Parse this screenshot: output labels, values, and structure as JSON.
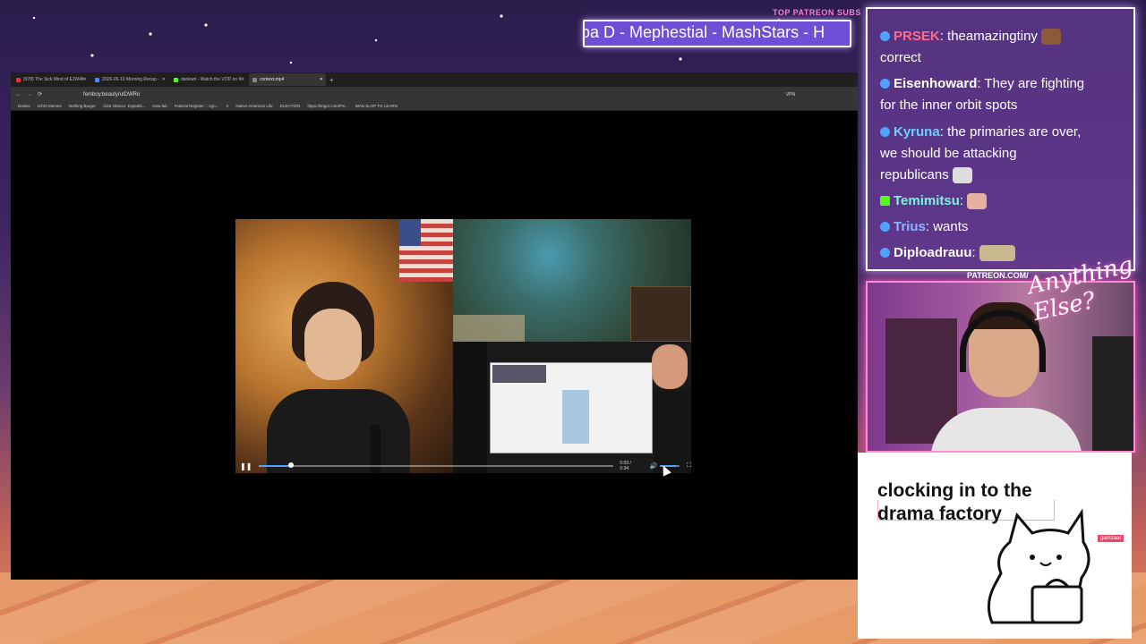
{
  "overlay": {
    "top_label": "TOP PATREON SUBS",
    "ticker_text": "oa D - Mephestial - MashStars - H",
    "patreon_label": "PATREON.COM/",
    "script_logo": "Anything Else?",
    "note_text": "clocking in to the drama factory",
    "note_tag": "gamzaar"
  },
  "browser": {
    "tabs": [
      {
        "label": "(978) The Sick Mind of EJW4K",
        "color": "#e33"
      },
      {
        "label": "2026-06-10 Morning Recap - ",
        "color": "#4a8cff"
      },
      {
        "label": "dankwrl - Watch the VOD on K",
        "color": "#53fc18"
      },
      {
        "label": "context.mp4",
        "color": "#888"
      }
    ],
    "new_tab": "+",
    "url": "femboy.beauty/utDWRo",
    "vpn_label": "VPN",
    "bookmarks": [
      "Dailies",
      "10/10 Memes",
      "Nothing Burger",
      "Clair Obscur: Expediti...",
      "Now lab",
      "Federal Register :: Ago...",
      "X",
      "Native American Libr",
      "ELECTION",
      "https://imgur.com/PS...",
      "WAN SLOP TO LEARN"
    ]
  },
  "video": {
    "time": "0:03 / 0:34",
    "progress": 0.09,
    "volume": 0.85,
    "play_icon": "pause-icon"
  },
  "chat": {
    "messages": [
      {
        "user": "PRSEK",
        "text": ": theamazingtiny",
        "line2": "correct",
        "color": "#ff6b8b",
        "badge": "#4ea3ff"
      },
      {
        "user": "Eisenhoward",
        "text": ": They are fighting",
        "line2": "for the inner orbit spots",
        "color": "#ffffff",
        "badge": "#4ea3ff"
      },
      {
        "user": "Kyruna",
        "text": ": the primaries are over,",
        "line2": "we should be attacking",
        "line3": "republicans",
        "color": "#6ad1ff",
        "badge": "#4ea3ff"
      },
      {
        "user": "Temimitsu",
        "text": ":",
        "color": "#7df0e0",
        "badge": "#53fc18"
      },
      {
        "user": "Trius",
        "text": ": wants",
        "color": "#8ab4ff",
        "badge": "#4ea3ff"
      },
      {
        "user": "Diploadrauu",
        "text": ":",
        "color": "#ffffff",
        "badge": "#4ea3ff"
      }
    ]
  }
}
